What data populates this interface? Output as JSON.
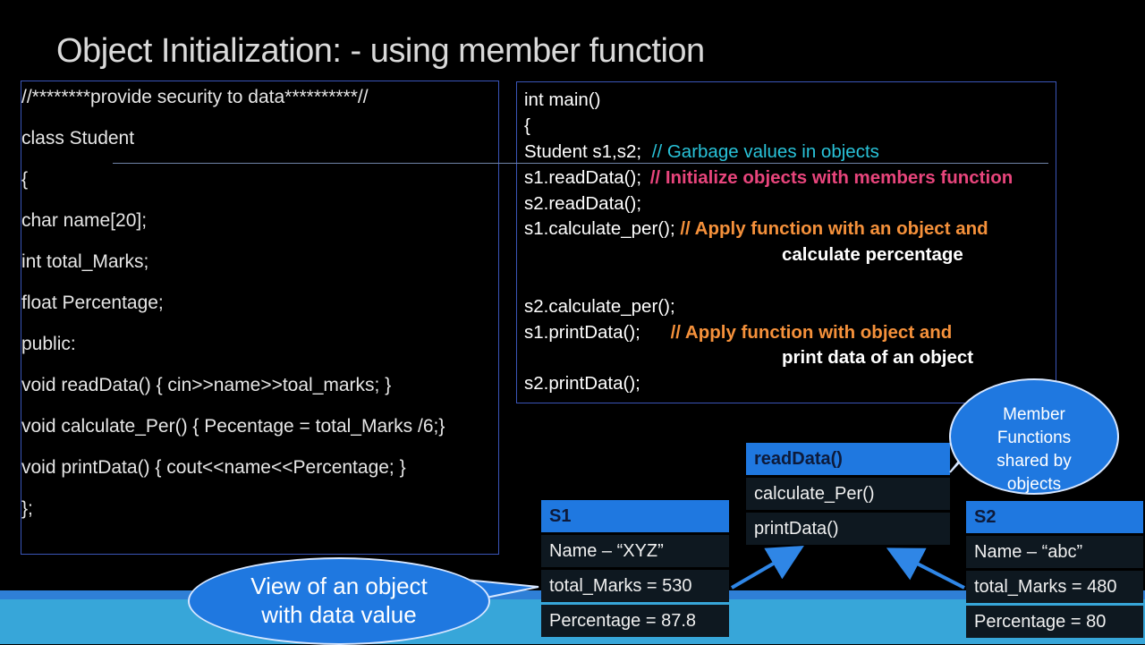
{
  "title": "Object Initialization: - using member function",
  "left_code": [
    "//********provide  security to data**********//",
    "class Student",
    "{",
    "char name[20];",
    "int total_Marks;",
    "float Percentage;",
    "public:",
    "void readData() { cin>>name>>toal_marks;  }",
    "void calculate_Per() { Pecentage = total_Marks /6;}",
    "void printData() { cout<<name<<Percentage;  }",
    "};"
  ],
  "right_code": {
    "line1": "int main()",
    "line2": "{",
    "line3_code": "Student s1,s2;",
    "line3_comment": "// Garbage values in objects",
    "line4_code": "s1.readData();",
    "line4_comment": "// Initialize objects with members function",
    "line5": "s2.readData();",
    "line6_code": "s1.calculate_per();",
    "line6_comment": "// Apply function with an object and",
    "line6_comment_cont": "calculate percentage",
    "line7": "s2.calculate_per();",
    "line8_code": "s1.printData();",
    "line8_comment": "// Apply function with object and",
    "line8_comment_cont": "print data of an object",
    "line9": "s2.printData();"
  },
  "s1": {
    "header": "S1",
    "name": "Name – “XYZ”",
    "marks": "total_Marks = 530",
    "percentage": "Percentage = 87.8"
  },
  "s2": {
    "header": "S2",
    "name": "Name – “abc”",
    "marks": "total_Marks = 480",
    "percentage": "Percentage = 80"
  },
  "functions": {
    "header": "readData()",
    "f2": "calculate_Per()",
    "f3": "printData()"
  },
  "bubble_member": {
    "l1": "Member",
    "l2": "Functions",
    "l3": "shared by",
    "l4": "objects"
  },
  "bubble_view": {
    "l1": "View of an object",
    "l2": "with data value"
  },
  "colors": {
    "header_blue": "#1f78e0",
    "band": "#37a6d9",
    "comment_cyan": "#29c3d9",
    "comment_pink": "#e8457c",
    "comment_orange": "#f5913b"
  }
}
